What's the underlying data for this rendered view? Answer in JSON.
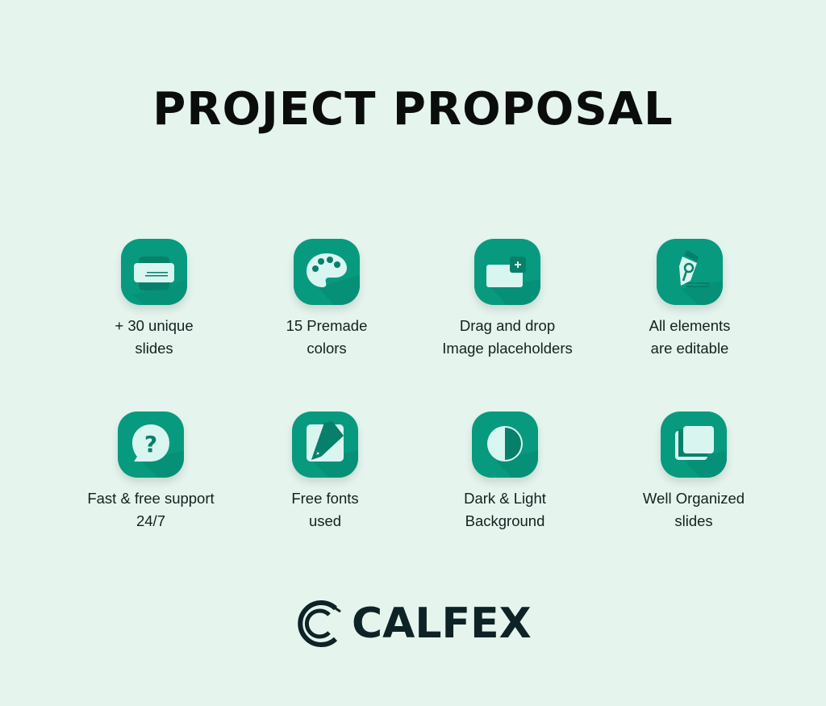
{
  "title": "PROJECT PROPOSAL",
  "colors": {
    "background": "#e5f5ee",
    "icon_bg": "#079a7f",
    "icon_dark": "#06806a",
    "icon_light": "#d9f5f0",
    "text": "#14211e",
    "brand": "#0e2326"
  },
  "features": [
    {
      "icon": "slides-icon",
      "line1": "+ 30 unique",
      "line2": "slides"
    },
    {
      "icon": "palette-icon",
      "line1": "15 Premade",
      "line2": "colors"
    },
    {
      "icon": "image-placeholder-icon",
      "line1": "Drag and drop",
      "line2": "Image placeholders"
    },
    {
      "icon": "pen-nib-icon",
      "line1": "All elements",
      "line2": "are editable"
    },
    {
      "icon": "question-bubble-icon",
      "line1": "Fast & free support",
      "line2": "24/7"
    },
    {
      "icon": "pencil-icon",
      "line1": "Free fonts",
      "line2": "used"
    },
    {
      "icon": "contrast-icon",
      "line1": "Dark & Light",
      "line2": "Background"
    },
    {
      "icon": "stacked-slides-icon",
      "line1": "Well Organized",
      "line2": "slides"
    }
  ],
  "brand": {
    "name": "CALFEX",
    "logo_icon": "calfex-logo-icon"
  }
}
